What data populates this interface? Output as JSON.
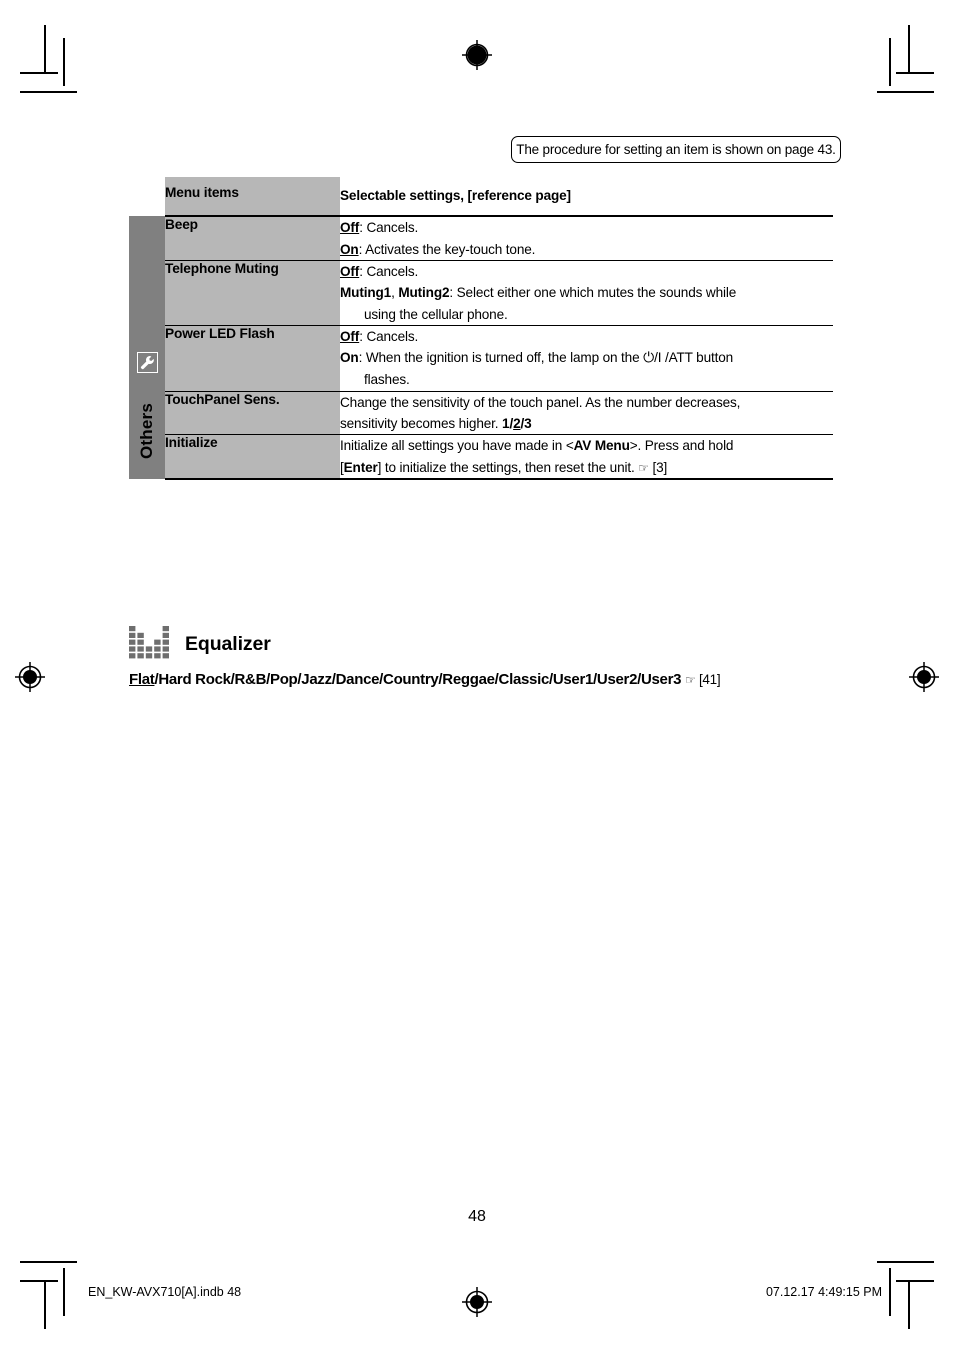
{
  "note": {
    "text": "The procedure for setting an item is shown on page 43."
  },
  "table": {
    "headers": {
      "menu": "Menu items",
      "settings": "Selectable settings, [reference page]"
    },
    "group_label": "Others",
    "group_icon": "wrench-icon",
    "rows": [
      {
        "menu": "Beep",
        "lines": [
          {
            "segments": [
              {
                "t": "Off",
                "style": "bold-underline"
              },
              {
                "t": ": Cancels.",
                "style": "plain"
              }
            ]
          },
          {
            "segments": [
              {
                "t": "On",
                "style": "bold-underline"
              },
              {
                "t": ": Activates the key-touch tone.",
                "style": "plain"
              }
            ]
          }
        ]
      },
      {
        "menu": "Telephone Muting",
        "lines": [
          {
            "segments": [
              {
                "t": "Off",
                "style": "bold-underline"
              },
              {
                "t": ": Cancels.",
                "style": "plain"
              }
            ]
          },
          {
            "segments": [
              {
                "t": "Muting1",
                "style": "bold"
              },
              {
                "t": ", ",
                "style": "plain"
              },
              {
                "t": "Muting2",
                "style": "bold"
              },
              {
                "t": ": Select either one which mutes the sounds while",
                "style": "plain"
              }
            ]
          },
          {
            "indent": true,
            "segments": [
              {
                "t": "using the cellular phone.",
                "style": "plain"
              }
            ]
          }
        ]
      },
      {
        "menu": "Power LED Flash",
        "lines": [
          {
            "segments": [
              {
                "t": "Off",
                "style": "bold-underline"
              },
              {
                "t": ": Cancels.",
                "style": "plain"
              }
            ]
          },
          {
            "segments": [
              {
                "t": "On",
                "style": "bold"
              },
              {
                "t": ": When the ignition is turned off, the lamp on the ",
                "style": "plain"
              },
              {
                "t": "power-icon",
                "style": "icon"
              },
              {
                "t": "/I /ATT button",
                "style": "plain"
              }
            ]
          },
          {
            "indent": true,
            "segments": [
              {
                "t": "flashes.",
                "style": "plain"
              }
            ]
          }
        ]
      },
      {
        "menu": "TouchPanel Sens.",
        "lines": [
          {
            "segments": [
              {
                "t": "Change the sensitivity of the touch panel. As the number decreases,",
                "style": "plain"
              }
            ]
          },
          {
            "segments": [
              {
                "t": "sensitivity becomes higher. ",
                "style": "plain"
              },
              {
                "t": "1",
                "style": "bold"
              },
              {
                "t": "/",
                "style": "bold"
              },
              {
                "t": "2",
                "style": "bold-underline"
              },
              {
                "t": "/",
                "style": "bold"
              },
              {
                "t": "3",
                "style": "bold"
              }
            ]
          }
        ]
      },
      {
        "menu": "Initialize",
        "lines": [
          {
            "segments": [
              {
                "t": "Initialize all settings you have made in <",
                "style": "plain"
              },
              {
                "t": "AV Menu",
                "style": "bold"
              },
              {
                "t": ">. Press and hold",
                "style": "plain"
              }
            ]
          },
          {
            "segments": [
              {
                "t": "[",
                "style": "plain"
              },
              {
                "t": "Enter",
                "style": "bold"
              },
              {
                "t": "] to initialize the settings, then reset the unit. ",
                "style": "plain"
              },
              {
                "t": "pointing-hand-icon",
                "style": "icon"
              },
              {
                "t": " [3]",
                "style": "plain"
              }
            ]
          }
        ]
      }
    ]
  },
  "equalizer": {
    "icon": "equalizer-icon",
    "title": "Equalizer",
    "presets_prefix": "Flat",
    "presets_rest": "/Hard Rock/R&B/Pop/Jazz/Dance/Country/Reggae/Classic/User1/User2/User3",
    "reference": "[41]"
  },
  "page_number": "48",
  "footer": {
    "file": "EN_KW-AVX710[A].indb   48",
    "timestamp": "07.12.17   4:49:15 PM"
  },
  "colors": {
    "sidebar_gray": "#808080",
    "menu_gray": "#b7b7b7",
    "rule_black": "#000000"
  }
}
